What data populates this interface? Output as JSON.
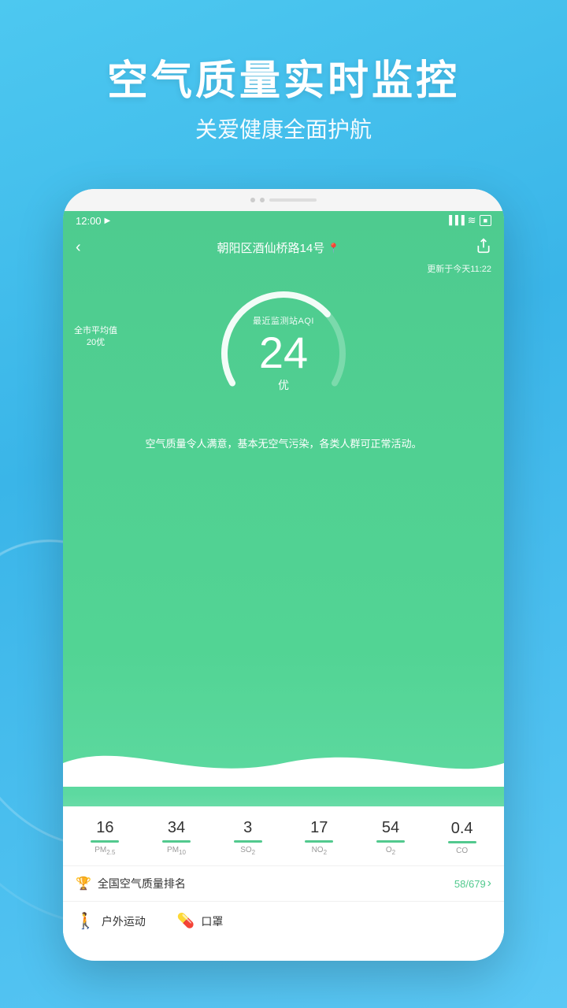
{
  "page": {
    "background": "#4ab8e8"
  },
  "header": {
    "title": "空气质量实时监控",
    "subtitle": "关爱健康全面护航"
  },
  "phone": {
    "status_bar": {
      "time": "12:00",
      "nav_arrow": "◀",
      "signal": "▐▐▐",
      "wifi": "WiFi",
      "battery": "■"
    },
    "nav": {
      "back_label": "‹",
      "location": "朝阳区酒仙桥路14号",
      "location_icon": "📍",
      "share_icon": "↗"
    },
    "update_time": "更新于今天11:22",
    "city_avg_label": "全市平均值",
    "city_avg_value": "20优",
    "aqi": {
      "label": "最近监测站AQI",
      "value": "24",
      "quality": "优"
    },
    "description": "空气质量令人满意，基本无空气污染，各类人群可正常活动。",
    "pollution": [
      {
        "value": "16",
        "label": "PM",
        "sub": "2.5",
        "color": "#52c98e"
      },
      {
        "value": "34",
        "label": "PM",
        "sub": "10",
        "color": "#52c98e"
      },
      {
        "value": "3",
        "label": "SO",
        "sub": "2",
        "color": "#52c98e"
      },
      {
        "value": "17",
        "label": "NO",
        "sub": "2",
        "color": "#52c98e"
      },
      {
        "value": "54",
        "label": "O",
        "sub": "2",
        "color": "#52c98e"
      },
      {
        "value": "0.4",
        "label": "CO",
        "sub": "",
        "color": "#52c98e"
      }
    ],
    "ranking": {
      "label": "全国空气质量排名",
      "value": "58/679",
      "arrow": "›"
    },
    "bottom_items": [
      {
        "icon": "🚶",
        "label": "户外运动"
      },
      {
        "icon": "💊",
        "label": "口罩"
      }
    ]
  }
}
